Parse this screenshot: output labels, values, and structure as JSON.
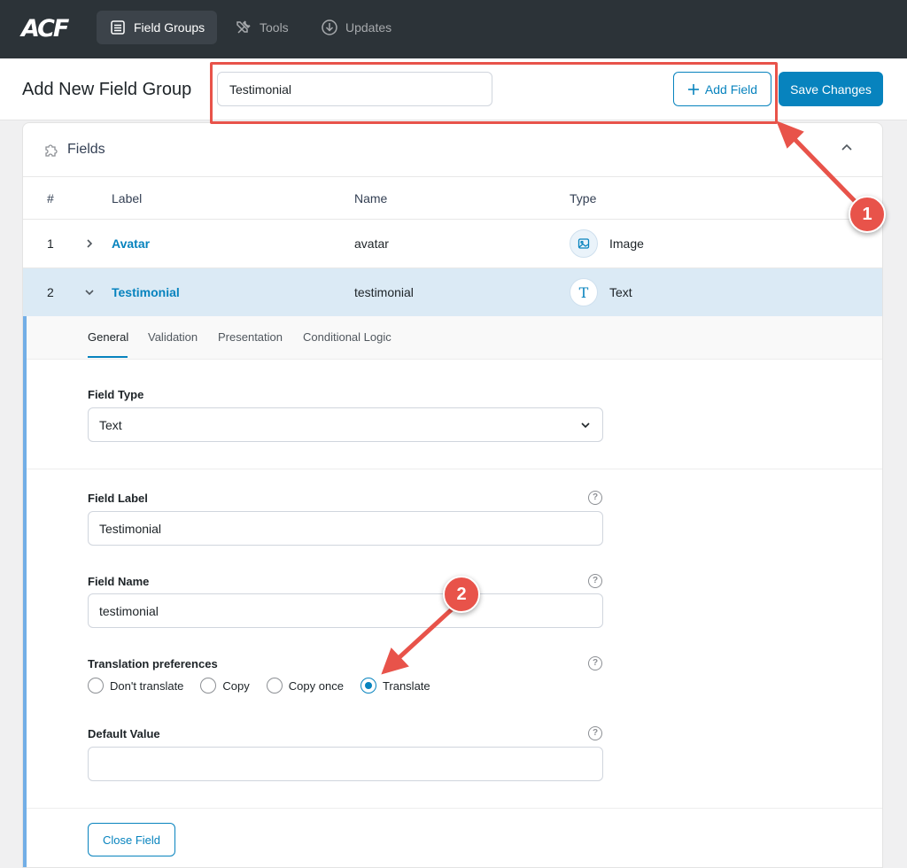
{
  "nav": {
    "logo": "ACF",
    "items": [
      {
        "label": "Field Groups",
        "icon": "list-icon",
        "active": true
      },
      {
        "label": "Tools",
        "icon": "tools-icon",
        "active": false
      },
      {
        "label": "Updates",
        "icon": "download-icon",
        "active": false
      }
    ]
  },
  "header": {
    "title": "Add New Field Group",
    "title_input_value": "Testimonial",
    "add_field_label": "Add Field",
    "save_label": "Save Changes"
  },
  "fields_panel": {
    "title": "Fields",
    "columns": [
      "#",
      "Label",
      "Name",
      "Type"
    ],
    "rows": [
      {
        "num": "1",
        "label": "Avatar",
        "name": "avatar",
        "type": "Image",
        "type_icon": "image-icon",
        "open": false
      },
      {
        "num": "2",
        "label": "Testimonial",
        "name": "testimonial",
        "type": "Text",
        "type_icon": "text-icon",
        "open": true
      }
    ]
  },
  "field_settings": {
    "tabs": [
      "General",
      "Validation",
      "Presentation",
      "Conditional Logic"
    ],
    "active_tab": "General",
    "field_type_label": "Field Type",
    "field_type_value": "Text",
    "field_label_label": "Field Label",
    "field_label_value": "Testimonial",
    "field_name_label": "Field Name",
    "field_name_value": "testimonial",
    "translation_label": "Translation preferences",
    "translation_options": [
      "Don't translate",
      "Copy",
      "Copy once",
      "Translate"
    ],
    "translation_selected": "Translate",
    "default_value_label": "Default Value",
    "default_value": "",
    "close_label": "Close Field",
    "help_glyph": "?"
  },
  "callouts": [
    "1",
    "2"
  ],
  "colors": {
    "accent": "#0783be",
    "topbar": "#2c3338",
    "callout": "#e8534a",
    "row_open": "#dbeaf5"
  }
}
